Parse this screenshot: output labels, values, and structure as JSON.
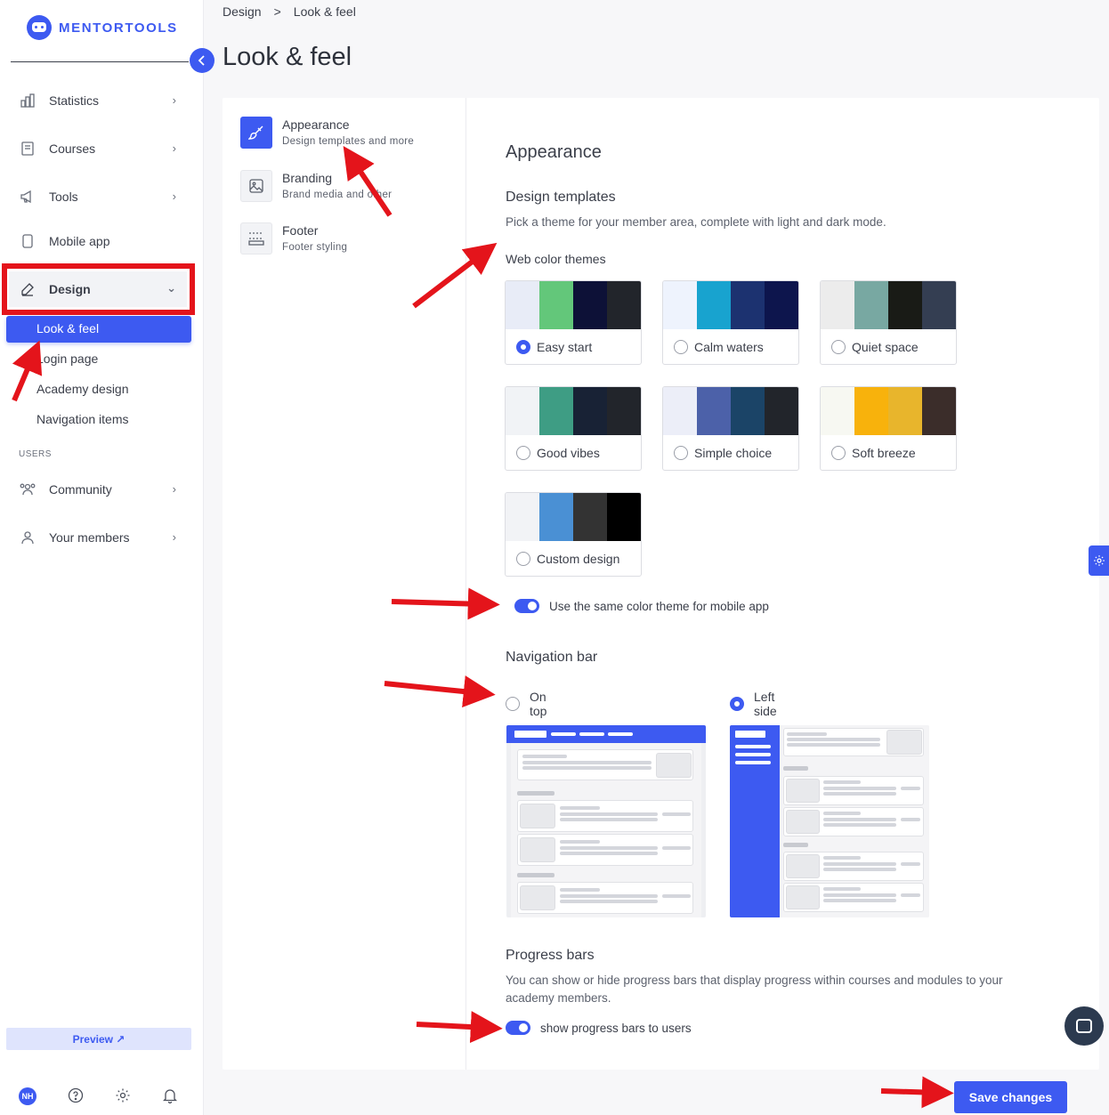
{
  "brand": {
    "name": "MENTORTOOLS"
  },
  "sidebar": {
    "items": [
      {
        "label": "Statistics",
        "icon": "bar-chart-icon"
      },
      {
        "label": "Courses",
        "icon": "book-icon"
      },
      {
        "label": "Tools",
        "icon": "megaphone-icon"
      },
      {
        "label": "Mobile app",
        "icon": "phone-icon"
      },
      {
        "label": "Design",
        "icon": "pencil-icon"
      }
    ],
    "design_sub": [
      "Look & feel",
      "Login page",
      "Academy design",
      "Navigation items"
    ],
    "users_label": "USERS",
    "users_items": [
      {
        "label": "Community",
        "icon": "people-icon"
      },
      {
        "label": "Your members",
        "icon": "person-icon"
      }
    ],
    "preview_label": "Preview ↗",
    "avatar_initials": "NH"
  },
  "breadcrumb": {
    "parent": "Design",
    "separator": ">",
    "current": "Look & feel"
  },
  "page_title": "Look & feel",
  "tabs": [
    {
      "title": "Appearance",
      "subtitle": "Design templates and more"
    },
    {
      "title": "Branding",
      "subtitle": "Brand media and other"
    },
    {
      "title": "Footer",
      "subtitle": "Footer styling"
    }
  ],
  "appearance": {
    "heading": "Appearance",
    "design_templates": {
      "heading": "Design templates",
      "description": "Pick a theme for your member area, complete with light and dark mode.",
      "web_color_themes_label": "Web color themes",
      "themes": [
        {
          "name": "Easy start",
          "selected": true,
          "colors": [
            "#e8ecf7",
            "#63c77a",
            "#0d1137",
            "#22252b"
          ]
        },
        {
          "name": "Calm waters",
          "selected": false,
          "colors": [
            "#eef3fd",
            "#18a3cf",
            "#1c3270",
            "#0d154d"
          ]
        },
        {
          "name": "Quiet space",
          "selected": false,
          "colors": [
            "#ececec",
            "#78a8a2",
            "#191b16",
            "#343e52"
          ]
        },
        {
          "name": "Good vibes",
          "selected": false,
          "colors": [
            "#f1f3f6",
            "#3e9d84",
            "#182235",
            "#22252b"
          ]
        },
        {
          "name": "Simple choice",
          "selected": false,
          "colors": [
            "#eceef8",
            "#4c61a9",
            "#1b4467",
            "#22252b"
          ]
        },
        {
          "name": "Soft breeze",
          "selected": false,
          "colors": [
            "#f7f8f2",
            "#f8b20c",
            "#e8b52c",
            "#3b2d2a"
          ]
        },
        {
          "name": "Custom design",
          "selected": false,
          "colors": [
            "#f2f3f6",
            "#4a90d4",
            "#333333",
            "#000000"
          ]
        }
      ],
      "mobile_toggle_label": "Use the same color theme for mobile app",
      "mobile_toggle_on": true
    },
    "navigation_bar": {
      "heading": "Navigation bar",
      "options": [
        {
          "label": "On top",
          "selected": false
        },
        {
          "label": "Left side",
          "selected": true
        }
      ]
    },
    "progress_bars": {
      "heading": "Progress bars",
      "description_line1": "You can show or hide progress bars that display progress within courses and modules to your",
      "description_line2": "academy members.",
      "toggle_label": "show progress bars to users",
      "toggle_on": true
    }
  },
  "save_label": "Save changes",
  "colors": {
    "accent": "#3d5af1",
    "annotation": "#e4141b"
  }
}
